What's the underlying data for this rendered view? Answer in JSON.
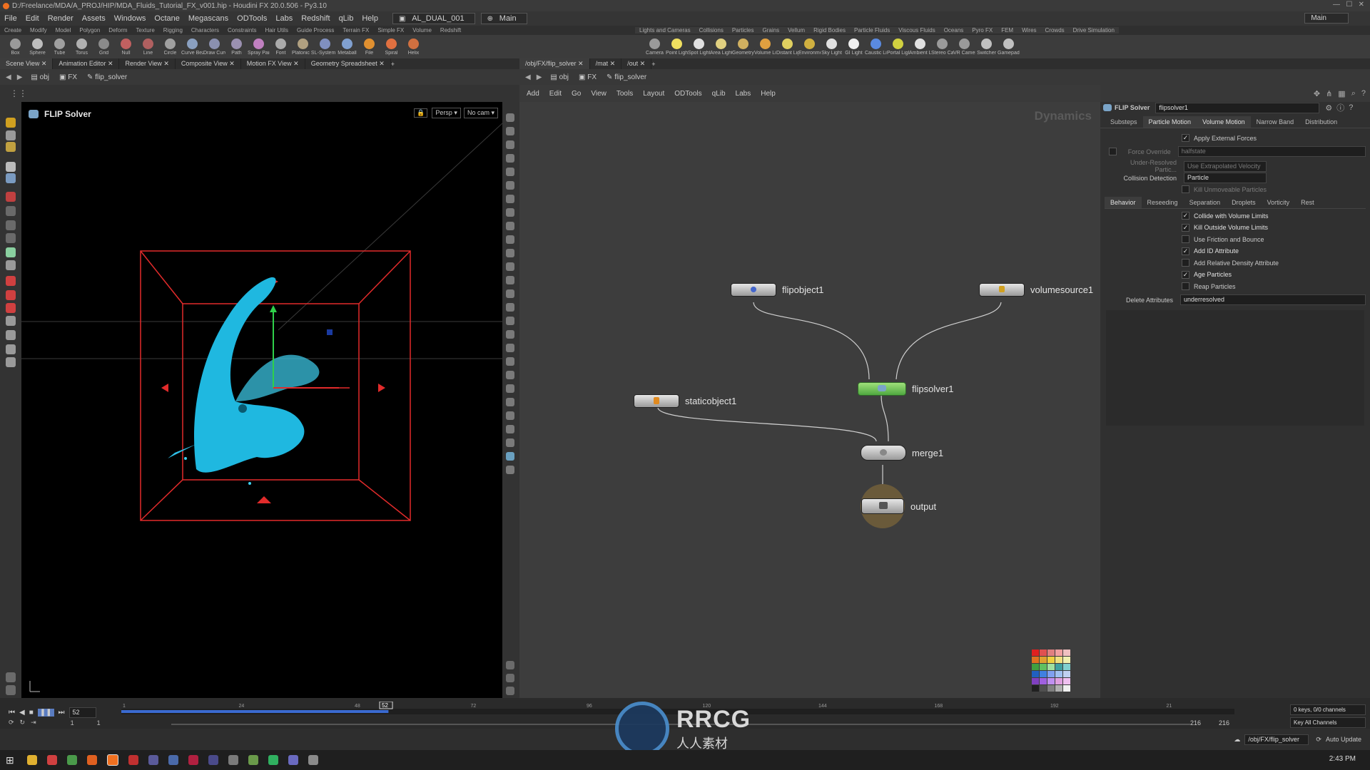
{
  "title": "D:/Freelance/MDA/A_PROJ/HIP/MDA_Fluids_Tutorial_FX_v001.hip - Houdini FX 20.0.506 - Py3.10",
  "menu": [
    "File",
    "Edit",
    "Render",
    "Assets",
    "Windows",
    "Octane",
    "Megascans",
    "ODTools",
    "Labs",
    "Redshift",
    "qLib",
    "Help"
  ],
  "desktop": {
    "label": "AL_DUAL_001",
    "main": "Main"
  },
  "shelf_tabs_left": [
    "Create",
    "Modify",
    "Model",
    "Polygon",
    "Deform",
    "Texture",
    "Rigging",
    "Characters",
    "Constraints",
    "Hair Utils",
    "Guide Process",
    "Terrain FX",
    "Simple FX",
    "Volume",
    "Redshift"
  ],
  "shelf_tabs_right": [
    "Lights and Cameras",
    "Collisions",
    "Particles",
    "Grains",
    "Vellum",
    "Rigid Bodies",
    "Particle Fluids",
    "Viscous Fluids",
    "Oceans",
    "Pyro FX",
    "FEM",
    "Wires",
    "Crowds",
    "Drive Simulation"
  ],
  "tools_left": [
    "Box",
    "Sphere",
    "Tube",
    "Torus",
    "Grid",
    "Null",
    "Line",
    "Circle",
    "Curve Bezier",
    "Draw Curve",
    "Path",
    "Spray Paint",
    "Font",
    "Platonic Solids",
    "L-System",
    "Metaball",
    "File",
    "Spiral",
    "Helix"
  ],
  "tools_right": [
    "Camera",
    "Point Light",
    "Spot Light",
    "Area Light",
    "Geometry Light",
    "Volume Light",
    "Distant Light",
    "Environment Light",
    "Sky Light",
    "GI Light",
    "Caustic Light",
    "Portal Light",
    "Ambient Light",
    "Stereo Camera",
    "VR Camera",
    "Switcher",
    "Gamepad Camera"
  ],
  "left_tabs": [
    "Scene View",
    "Animation Editor",
    "Render View",
    "Composite View",
    "Motion FX View",
    "Geometry Spreadsheet"
  ],
  "right_tabs": [
    "/obj/FX/flip_solver",
    "/mat",
    "/out"
  ],
  "left_path": [
    "obj",
    "FX",
    "flip_solver"
  ],
  "right_path": [
    "obj",
    "FX",
    "flip_solver"
  ],
  "viewport": {
    "name": "FLIP Solver",
    "persp": "Persp",
    "cam": "No cam"
  },
  "net_menu": [
    "Add",
    "Edit",
    "Go",
    "View",
    "Tools",
    "Layout",
    "ODTools",
    "qLib",
    "Labs",
    "Help"
  ],
  "net_context": "Dynamics",
  "nodes": {
    "flipobject": "flipobject1",
    "volumesource": "volumesource1",
    "flipsolver": "flipsolver1",
    "staticobject": "staticobject1",
    "merge": "merge1",
    "output": "output"
  },
  "params": {
    "type": "FLIP Solver",
    "node": "flipsolver1",
    "tabs": [
      "Substeps",
      "Particle Motion",
      "Volume Motion",
      "Narrow Band",
      "Distribution"
    ],
    "apply_forces": "Apply External Forces",
    "force_override": "Force Override",
    "force_override_value": "halfstate",
    "under_resolved": "Under-Resolved Partic...",
    "under_resolved_value": "Use Extrapolated Velocity",
    "collision_label": "Collision Detection",
    "collision_value": "Particle",
    "kill_unmoveable": "Kill Unmoveable Particles",
    "sub_tabs": [
      "Behavior",
      "Reseeding",
      "Separation",
      "Droplets",
      "Vorticity",
      "Rest"
    ],
    "checks": [
      {
        "label": "Collide with Volume Limits",
        "checked": true
      },
      {
        "label": "Kill Outside Volume Limits",
        "checked": true
      },
      {
        "label": "Use Friction and Bounce",
        "checked": false
      },
      {
        "label": "Add ID Attribute",
        "checked": true
      },
      {
        "label": "Add Relative Density Attribute",
        "checked": false
      },
      {
        "label": "Age Particles",
        "checked": true
      },
      {
        "label": "Reap Particles",
        "checked": false
      }
    ],
    "delete_label": "Delete Attributes",
    "delete_value": "underresolved"
  },
  "timeline": {
    "frame": "52",
    "ticks": [
      "1",
      "24",
      "48",
      "72",
      "96",
      "120",
      "144",
      "168",
      "192",
      "21"
    ],
    "start": "1",
    "start2": "1",
    "end": "216",
    "end2": "216",
    "keys": "0 keys, 0/0 channels",
    "key_all": "Key All Channels",
    "progress": 0.24
  },
  "status": {
    "path": "/obj/FX/flip_solver",
    "update": "Auto Update"
  },
  "watermark": {
    "text": "RRCG",
    "sub": "人人素材"
  },
  "clock": "2:43 PM"
}
